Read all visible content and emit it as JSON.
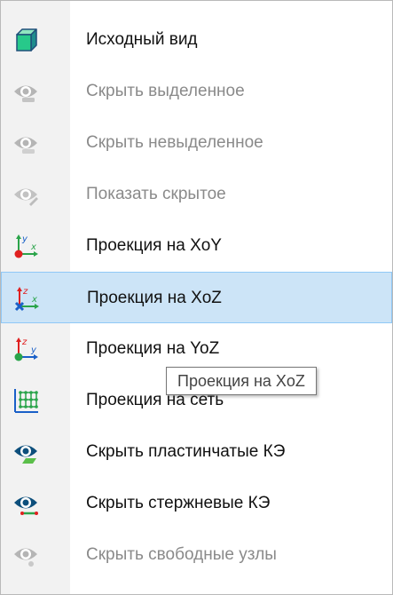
{
  "menu": {
    "items": [
      {
        "label": "Исходный вид",
        "icon": "cube-icon",
        "enabled": true
      },
      {
        "label": "Скрыть выделенное",
        "icon": "eye-hide-selected-icon",
        "enabled": false
      },
      {
        "label": "Скрыть невыделенное",
        "icon": "eye-hide-unselected-icon",
        "enabled": false
      },
      {
        "label": "Показать скрытое",
        "icon": "eye-show-hidden-icon",
        "enabled": false
      },
      {
        "label": "Проекция на XoY",
        "icon": "axes-xoy-icon",
        "enabled": true
      },
      {
        "label": "Проекция на XoZ",
        "icon": "axes-xoz-icon",
        "enabled": true,
        "highlighted": true
      },
      {
        "label": "Проекция на YoZ",
        "icon": "axes-yoz-icon",
        "enabled": true
      },
      {
        "label": "Проекция на сеть",
        "icon": "grid-projection-icon",
        "enabled": true
      },
      {
        "label": "Скрыть пластинчатые КЭ",
        "icon": "eye-hide-plates-icon",
        "enabled": true
      },
      {
        "label": "Скрыть стержневые КЭ",
        "icon": "eye-hide-bars-icon",
        "enabled": true
      },
      {
        "label": "Скрыть свободные узлы",
        "icon": "eye-hide-nodes-icon",
        "enabled": false
      }
    ]
  },
  "tooltip": {
    "text": "Проекция на XoZ"
  },
  "axis_letters": {
    "x": "x",
    "y": "y",
    "z": "z"
  },
  "colors": {
    "highlight_bg": "#cce4f7",
    "highlight_border": "#90c8f6",
    "eye_active": "#0d4f7c",
    "eye_disabled": "#a5a5a5",
    "axis_green": "#2aa44a",
    "axis_red": "#e02020",
    "axis_blue": "#1a60c8"
  }
}
